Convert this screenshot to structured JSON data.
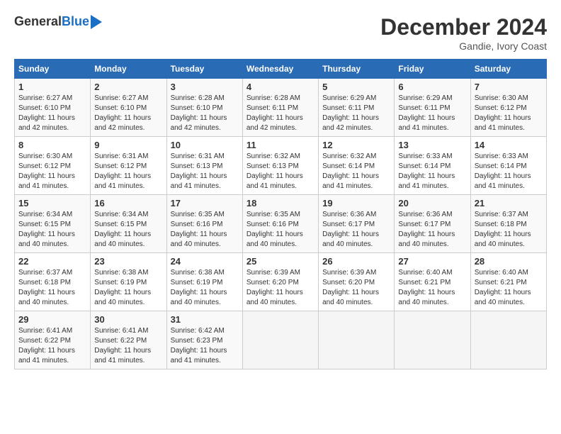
{
  "header": {
    "logo_general": "General",
    "logo_blue": "Blue",
    "month_title": "December 2024",
    "location": "Gandie, Ivory Coast"
  },
  "weekdays": [
    "Sunday",
    "Monday",
    "Tuesday",
    "Wednesday",
    "Thursday",
    "Friday",
    "Saturday"
  ],
  "weeks": [
    [
      {
        "day": "1",
        "sunrise": "6:27 AM",
        "sunset": "6:10 PM",
        "daylight": "11 hours and 42 minutes."
      },
      {
        "day": "2",
        "sunrise": "6:27 AM",
        "sunset": "6:10 PM",
        "daylight": "11 hours and 42 minutes."
      },
      {
        "day": "3",
        "sunrise": "6:28 AM",
        "sunset": "6:10 PM",
        "daylight": "11 hours and 42 minutes."
      },
      {
        "day": "4",
        "sunrise": "6:28 AM",
        "sunset": "6:11 PM",
        "daylight": "11 hours and 42 minutes."
      },
      {
        "day": "5",
        "sunrise": "6:29 AM",
        "sunset": "6:11 PM",
        "daylight": "11 hours and 42 minutes."
      },
      {
        "day": "6",
        "sunrise": "6:29 AM",
        "sunset": "6:11 PM",
        "daylight": "11 hours and 41 minutes."
      },
      {
        "day": "7",
        "sunrise": "6:30 AM",
        "sunset": "6:12 PM",
        "daylight": "11 hours and 41 minutes."
      }
    ],
    [
      {
        "day": "8",
        "sunrise": "6:30 AM",
        "sunset": "6:12 PM",
        "daylight": "11 hours and 41 minutes."
      },
      {
        "day": "9",
        "sunrise": "6:31 AM",
        "sunset": "6:12 PM",
        "daylight": "11 hours and 41 minutes."
      },
      {
        "day": "10",
        "sunrise": "6:31 AM",
        "sunset": "6:13 PM",
        "daylight": "11 hours and 41 minutes."
      },
      {
        "day": "11",
        "sunrise": "6:32 AM",
        "sunset": "6:13 PM",
        "daylight": "11 hours and 41 minutes."
      },
      {
        "day": "12",
        "sunrise": "6:32 AM",
        "sunset": "6:14 PM",
        "daylight": "11 hours and 41 minutes."
      },
      {
        "day": "13",
        "sunrise": "6:33 AM",
        "sunset": "6:14 PM",
        "daylight": "11 hours and 41 minutes."
      },
      {
        "day": "14",
        "sunrise": "6:33 AM",
        "sunset": "6:14 PM",
        "daylight": "11 hours and 41 minutes."
      }
    ],
    [
      {
        "day": "15",
        "sunrise": "6:34 AM",
        "sunset": "6:15 PM",
        "daylight": "11 hours and 40 minutes."
      },
      {
        "day": "16",
        "sunrise": "6:34 AM",
        "sunset": "6:15 PM",
        "daylight": "11 hours and 40 minutes."
      },
      {
        "day": "17",
        "sunrise": "6:35 AM",
        "sunset": "6:16 PM",
        "daylight": "11 hours and 40 minutes."
      },
      {
        "day": "18",
        "sunrise": "6:35 AM",
        "sunset": "6:16 PM",
        "daylight": "11 hours and 40 minutes."
      },
      {
        "day": "19",
        "sunrise": "6:36 AM",
        "sunset": "6:17 PM",
        "daylight": "11 hours and 40 minutes."
      },
      {
        "day": "20",
        "sunrise": "6:36 AM",
        "sunset": "6:17 PM",
        "daylight": "11 hours and 40 minutes."
      },
      {
        "day": "21",
        "sunrise": "6:37 AM",
        "sunset": "6:18 PM",
        "daylight": "11 hours and 40 minutes."
      }
    ],
    [
      {
        "day": "22",
        "sunrise": "6:37 AM",
        "sunset": "6:18 PM",
        "daylight": "11 hours and 40 minutes."
      },
      {
        "day": "23",
        "sunrise": "6:38 AM",
        "sunset": "6:19 PM",
        "daylight": "11 hours and 40 minutes."
      },
      {
        "day": "24",
        "sunrise": "6:38 AM",
        "sunset": "6:19 PM",
        "daylight": "11 hours and 40 minutes."
      },
      {
        "day": "25",
        "sunrise": "6:39 AM",
        "sunset": "6:20 PM",
        "daylight": "11 hours and 40 minutes."
      },
      {
        "day": "26",
        "sunrise": "6:39 AM",
        "sunset": "6:20 PM",
        "daylight": "11 hours and 40 minutes."
      },
      {
        "day": "27",
        "sunrise": "6:40 AM",
        "sunset": "6:21 PM",
        "daylight": "11 hours and 40 minutes."
      },
      {
        "day": "28",
        "sunrise": "6:40 AM",
        "sunset": "6:21 PM",
        "daylight": "11 hours and 40 minutes."
      }
    ],
    [
      {
        "day": "29",
        "sunrise": "6:41 AM",
        "sunset": "6:22 PM",
        "daylight": "11 hours and 41 minutes."
      },
      {
        "day": "30",
        "sunrise": "6:41 AM",
        "sunset": "6:22 PM",
        "daylight": "11 hours and 41 minutes."
      },
      {
        "day": "31",
        "sunrise": "6:42 AM",
        "sunset": "6:23 PM",
        "daylight": "11 hours and 41 minutes."
      },
      null,
      null,
      null,
      null
    ]
  ]
}
